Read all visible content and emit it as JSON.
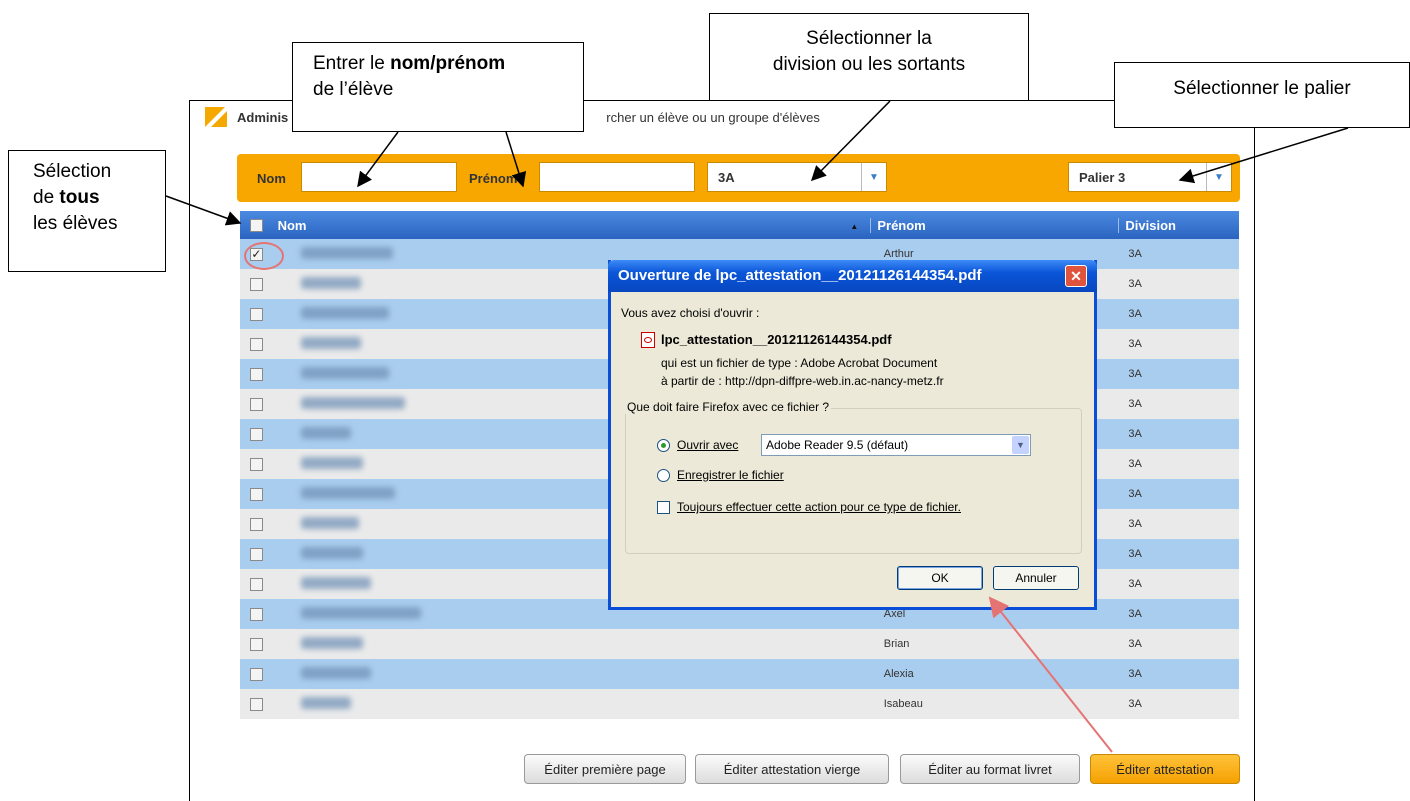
{
  "app": {
    "breadcrumb_start": "Adminis",
    "breadcrumb_end": "rcher un élève ou un groupe d'élèves"
  },
  "filters": {
    "nom_label": "Nom",
    "prenom_label": "Prénom",
    "division_value": "3A",
    "palier_value": "Palier 3"
  },
  "table": {
    "headers": {
      "nom": "Nom",
      "prenom": "Prénom",
      "division": "Division"
    },
    "rows": [
      {
        "prenom": "Arthur",
        "division": "3A",
        "checked": true
      },
      {
        "prenom": "",
        "division": "3A"
      },
      {
        "prenom": "",
        "division": "3A"
      },
      {
        "prenom": "",
        "division": "3A"
      },
      {
        "prenom": "",
        "division": "3A"
      },
      {
        "prenom": "",
        "division": "3A"
      },
      {
        "prenom": "",
        "division": "3A"
      },
      {
        "prenom": "",
        "division": "3A"
      },
      {
        "prenom": "",
        "division": "3A"
      },
      {
        "prenom": "",
        "division": "3A"
      },
      {
        "prenom": "",
        "division": "3A"
      },
      {
        "prenom": "",
        "division": "3A"
      },
      {
        "prenom": "Axel",
        "division": "3A"
      },
      {
        "prenom": "Brian",
        "division": "3A"
      },
      {
        "prenom": "Alexia",
        "division": "3A"
      },
      {
        "prenom": "Isabeau",
        "division": "3A"
      }
    ]
  },
  "buttons": {
    "premiere_page": "Éditer première page",
    "attestation_vierge": "Éditer attestation vierge",
    "format_livret": "Éditer au format livret",
    "attestation": "Éditer attestation"
  },
  "callouts": {
    "nom_prenom_a": "Entrer le ",
    "nom_prenom_b": "nom/prénom",
    "nom_prenom_c": "de l’élève",
    "division_a": "Sélectionner la",
    "division_b": "division ou les sortants",
    "palier": "Sélectionner le palier",
    "tous_a": "Sélection",
    "tous_b": "de ",
    "tous_c": "tous",
    "tous_d": "les élèves"
  },
  "dialog": {
    "title": "Ouverture de lpc_attestation__20121126144354.pdf",
    "chosen": "Vous avez choisi d'ouvrir :",
    "filename": "lpc_attestation__20121126144354.pdf",
    "type_line": "qui est un fichier de type :  Adobe Acrobat Document",
    "from_line": "à partir de :  http://dpn-diffpre-web.in.ac-nancy-metz.fr",
    "question": "Que doit faire Firefox avec ce fichier ?",
    "open_with": "Ouvrir avec",
    "app_value": "Adobe Reader 9.5 (défaut)",
    "save_file": "Enregistrer le fichier",
    "always": "Toujours effectuer cette action pour ce type de fichier.",
    "ok": "OK",
    "cancel": "Annuler"
  }
}
